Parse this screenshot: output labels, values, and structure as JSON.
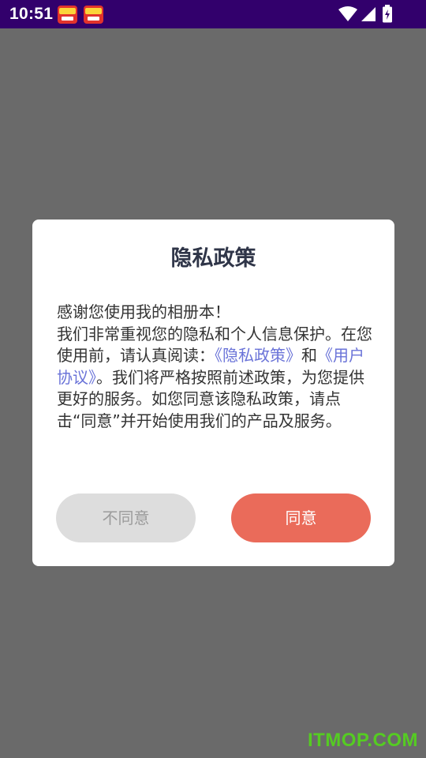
{
  "status_bar": {
    "time": "10:51",
    "notification_icons": [
      "app-notification-icon",
      "app-notification-icon"
    ],
    "system_icons": [
      "wifi-icon",
      "cell-signal-icon",
      "battery-charging-icon"
    ],
    "background_color": "#32006c"
  },
  "dialog": {
    "title": "隐私政策",
    "body_part1": "感谢您使用我的相册本！\n我们非常重视您的隐私和个人信息保护。在您使用前，请认真阅读：",
    "privacy_link": "《隐私政策》",
    "and_text": "和",
    "user_agreement_link": "《用户协议》",
    "body_part2": "。我们将严格按照前述政策，为您提供更好的服务。如您同意该隐私政策，请点击“同意”并开始使用我们的产品及服务。",
    "disagree_label": "不同意",
    "agree_label": "同意",
    "link_color": "#6a73d8",
    "agree_color": "#ea6b5a"
  },
  "watermark": "ITMOP.COM"
}
